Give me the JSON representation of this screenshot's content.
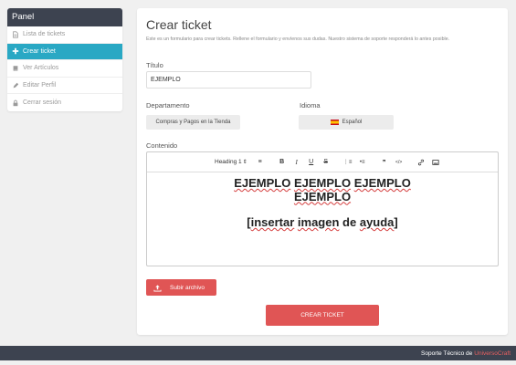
{
  "sidebar": {
    "title": "Panel",
    "items": [
      {
        "label": "Lista de tickets",
        "icon": "file-icon",
        "active": false
      },
      {
        "label": "Crear ticket",
        "icon": "plus-icon",
        "active": true
      },
      {
        "label": "Ver Artículos",
        "icon": "book-icon",
        "active": false
      },
      {
        "label": "Editar Perfil",
        "icon": "pencil-icon",
        "active": false
      },
      {
        "label": "Cerrar sesión",
        "icon": "lock-icon",
        "active": false
      }
    ]
  },
  "form": {
    "title": "Crear ticket",
    "subtitle": "Este es un formulario para crear tickets. Rellene el formulario y envíenos sus dudas. Nuestro sistema de soporte responderá lo antes posible.",
    "title_label": "Título",
    "title_value": "EJEMPLO",
    "department_label": "Departamento",
    "department_value": "Compras y Pagos en la Tienda",
    "language_label": "Idioma",
    "language_value": "Español",
    "content_label": "Contenido",
    "editor": {
      "heading_select": "Heading 1",
      "heading_arrow": "⇕",
      "align": "≡",
      "bold": "B",
      "italic": "I",
      "underline": "U",
      "strike": "S",
      "ordered_list": "⋮≡",
      "bullet_list": "•≡",
      "quote": "❞",
      "code": "</>",
      "link": "🔗",
      "image": "▣",
      "heading_words": [
        "EJEMPLO",
        "EJEMPLO",
        "EJEMPLO",
        "EJEMPLO"
      ],
      "placeholder_open": "[",
      "placeholder_words": [
        "insertar",
        "imagen",
        "de",
        "ayuda"
      ],
      "placeholder_close": "]"
    },
    "upload_label": "Subir archivo",
    "submit_label": "CREAR TICKET"
  },
  "footer": {
    "text": "Soporte Técnico de",
    "brand": "UniversoCraft"
  },
  "colors": {
    "accent": "#29a8c4",
    "danger": "#e05555",
    "dark": "#3d4350"
  }
}
